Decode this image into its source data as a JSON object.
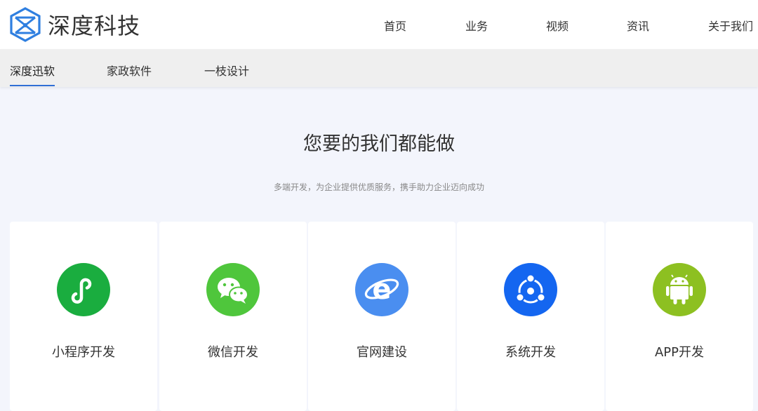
{
  "header": {
    "logo_text": "深度科技",
    "nav": [
      {
        "label": "首页"
      },
      {
        "label": "业务"
      },
      {
        "label": "视频"
      },
      {
        "label": "资讯"
      },
      {
        "label": "关于我们"
      }
    ]
  },
  "subnav": {
    "items": [
      {
        "label": "深度迅软",
        "active": true
      },
      {
        "label": "家政软件"
      },
      {
        "label": "一枝设计"
      }
    ],
    "active_color": "#2f6fd6"
  },
  "section": {
    "title": "您要的我们都能做",
    "subtitle": "多端开发，为企业提供优质服务，携手助力企业迈向成功"
  },
  "services": [
    {
      "label": "小程序开发",
      "icon": "mini-program-icon",
      "color": "#1aad3f"
    },
    {
      "label": "微信开发",
      "icon": "wechat-icon",
      "color": "#4fc63c"
    },
    {
      "label": "官网建设",
      "icon": "ie-browser-icon",
      "color": "#4a8ef0"
    },
    {
      "label": "系统开发",
      "icon": "share-network-icon",
      "color": "#1466f0"
    },
    {
      "label": "APP开发",
      "icon": "android-icon",
      "color": "#8dc021"
    }
  ],
  "colors": {
    "brand": "#2f6fd6",
    "page_background": "#f3f5fc"
  }
}
